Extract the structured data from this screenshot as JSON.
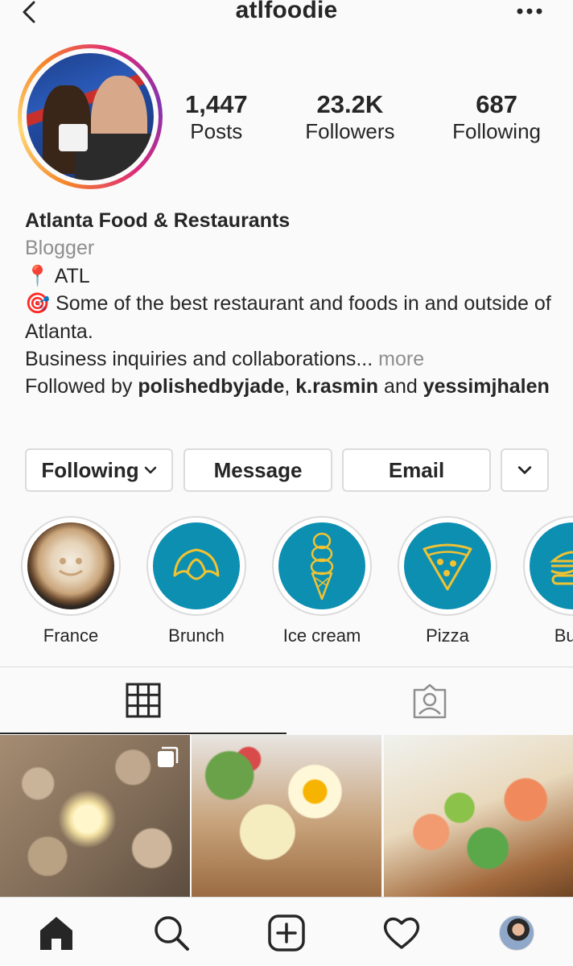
{
  "header": {
    "username": "atlfoodie"
  },
  "profile": {
    "stats": [
      {
        "value": "1,447",
        "label": "Posts"
      },
      {
        "value": "23.2K",
        "label": "Followers"
      },
      {
        "value": "687",
        "label": "Following"
      }
    ],
    "name": "Atlanta Food & Restaurants",
    "category": "Blogger",
    "bio_line_1": "📍 ATL",
    "bio_line_2": "🎯 Some of the best restaurant and foods in and outside of Atlanta.",
    "bio_line_3": "Business inquiries and collaborations...",
    "more_label": "more",
    "followed_by_prefix": "Followed by",
    "followed_by_user_1": "polishedbyjade",
    "followed_by_user_2": "k.rasmin",
    "followed_by_and": "and",
    "followed_by_user_3": "yessimjhalen"
  },
  "actions": {
    "following_label": "Following",
    "message_label": "Message",
    "email_label": "Email"
  },
  "highlights": [
    {
      "label": "France",
      "icon": "coffee-latte-photo"
    },
    {
      "label": "Brunch",
      "icon": "croissant-icon"
    },
    {
      "label": "Ice cream",
      "icon": "ice-cream-cone-icon"
    },
    {
      "label": "Pizza",
      "icon": "pizza-slice-icon"
    },
    {
      "label": "Burg",
      "icon": "burger-icon"
    }
  ],
  "tabs": [
    {
      "icon": "grid-icon",
      "active": true
    },
    {
      "icon": "tagged-person-icon",
      "active": false
    }
  ],
  "posts": [
    {
      "type": "carousel",
      "subject": "pasta with egg"
    },
    {
      "type": "single",
      "subject": "eggs benedict with salad"
    },
    {
      "type": "single",
      "subject": "smoked salmon avocado toast"
    }
  ],
  "bottom_nav": [
    {
      "icon": "home-icon",
      "active": true
    },
    {
      "icon": "search-icon",
      "active": false
    },
    {
      "icon": "add-post-icon",
      "active": false
    },
    {
      "icon": "heart-icon",
      "active": false
    },
    {
      "icon": "profile-avatar",
      "active": false
    }
  ],
  "colors": {
    "text": "#262626",
    "secondary": "#8e8e8e",
    "border": "#dbdbdb",
    "highlight_blue": "#0d8fb2",
    "highlight_icon_yellow": "#f1c232"
  }
}
